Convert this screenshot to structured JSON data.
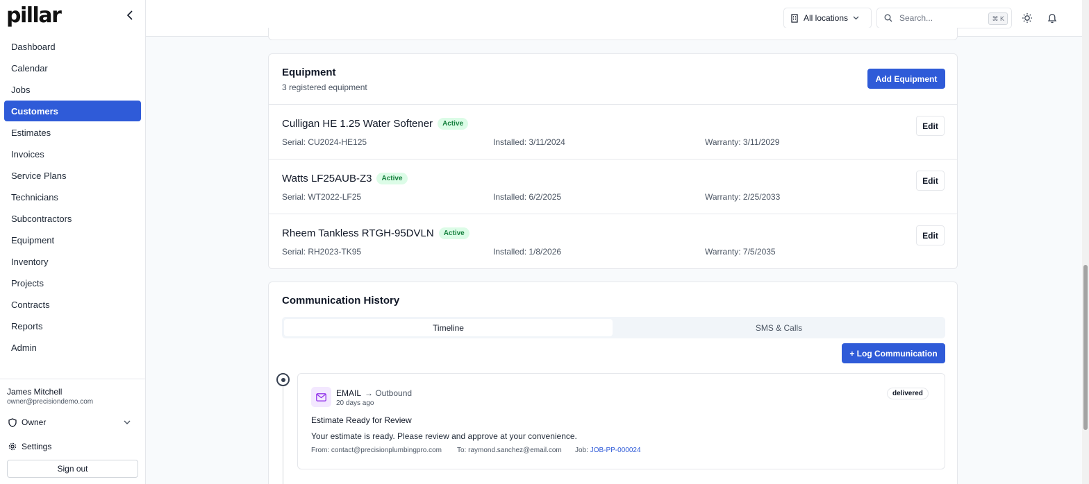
{
  "brand": {
    "logo_text": "pillar"
  },
  "sidebar": {
    "items": [
      {
        "label": "Dashboard",
        "active": false
      },
      {
        "label": "Calendar",
        "active": false
      },
      {
        "label": "Jobs",
        "active": false
      },
      {
        "label": "Customers",
        "active": true
      },
      {
        "label": "Estimates",
        "active": false
      },
      {
        "label": "Invoices",
        "active": false
      },
      {
        "label": "Service Plans",
        "active": false
      },
      {
        "label": "Technicians",
        "active": false
      },
      {
        "label": "Subcontractors",
        "active": false
      },
      {
        "label": "Equipment",
        "active": false
      },
      {
        "label": "Inventory",
        "active": false
      },
      {
        "label": "Projects",
        "active": false
      },
      {
        "label": "Contracts",
        "active": false
      },
      {
        "label": "Reports",
        "active": false
      },
      {
        "label": "Admin",
        "active": false
      }
    ],
    "user": {
      "name": "James Mitchell",
      "email": "owner@precisiondemo.com"
    },
    "role": "Owner",
    "settings_label": "Settings",
    "signout_label": "Sign out"
  },
  "header": {
    "location_label": "All locations",
    "search_placeholder": "Search...",
    "search_value": "",
    "shortcut": "⌘ K"
  },
  "equipment": {
    "title": "Equipment",
    "subtitle": "3 registered equipment",
    "add_label": "Add Equipment",
    "edit_label": "Edit",
    "items": [
      {
        "name": "Culligan HE 1.25 Water Softener",
        "status": "Active",
        "serial": "Serial: CU2024-HE125",
        "installed": "Installed: 3/11/2024",
        "warranty": "Warranty: 3/11/2029"
      },
      {
        "name": "Watts LF25AUB-Z3",
        "status": "Active",
        "serial": "Serial: WT2022-LF25",
        "installed": "Installed: 6/2/2025",
        "warranty": "Warranty: 2/25/2033"
      },
      {
        "name": "Rheem Tankless RTGH-95DVLN",
        "status": "Active",
        "serial": "Serial: RH2023-TK95",
        "installed": "Installed: 1/8/2026",
        "warranty": "Warranty: 7/5/2035"
      }
    ]
  },
  "communication": {
    "title": "Communication History",
    "tabs": [
      {
        "label": "Timeline",
        "active": true
      },
      {
        "label": "SMS & Calls",
        "active": false
      }
    ],
    "log_label": "+ Log Communication",
    "entries": [
      {
        "type": "EMAIL",
        "direction": "→ Outbound",
        "time": "20 days ago",
        "status": "delivered",
        "subject": "Estimate Ready for Review",
        "body": "Your estimate is ready. Please review and approve at your convenience.",
        "from": "From: contact@precisionplumbingpro.com",
        "to": "To: raymond.sanchez@email.com",
        "job_label": "Job:",
        "job_id": "JOB-PP-000024"
      }
    ]
  },
  "colors": {
    "accent": "#2f5bd8",
    "active_badge_bg": "#dcfce7",
    "active_badge_text": "#15803d",
    "email_icon": "#9333ea"
  },
  "icons": {
    "collapse": "chevron-left-icon",
    "location": "building-icon",
    "search": "search-icon",
    "theme": "sun-icon",
    "notifications": "bell-icon",
    "role": "shield-icon",
    "settings": "gear-icon",
    "email": "mail-icon",
    "timeline": "timeline-dot-icon"
  }
}
